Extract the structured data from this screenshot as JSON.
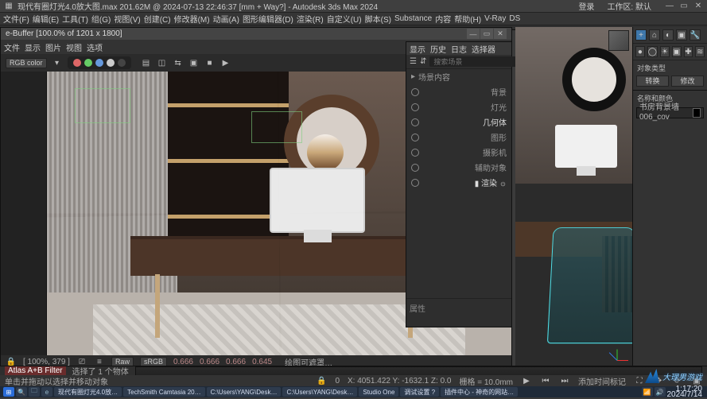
{
  "app": {
    "title": "现代有圈灯光4.0放大图.max  201.62M @ 2024-07-13 22:46:37  [mm + Way?]  - Autodesk 3ds Max 2024",
    "title_right_1": "登录",
    "title_right_2": "工作区: 默认"
  },
  "menubar": {
    "items": [
      "文件(F)",
      "编辑(E)",
      "工具(T)",
      "组(G)",
      "视图(V)",
      "创建(C)",
      "修改器(M)",
      "动画(A)",
      "图形编辑器(D)",
      "渲染(R)",
      "自定义(U)",
      "脚本(S)",
      "Substance",
      "内容",
      "帮助(H)",
      "V-Ray",
      "DS"
    ]
  },
  "frame_buffer": {
    "title": "e-Buffer  [100.0% of 1201 x 1800]",
    "win_btns": [
      "—",
      "▭",
      "✕"
    ],
    "topmenu": [
      "文件",
      "显示",
      "图片",
      "视图",
      "选项"
    ],
    "channel_label": "RGB color",
    "bottom_coord": "[ 100%, 379 ]",
    "bottom_mode_raw": "Raw",
    "bottom_mode_srgb": "sRGB",
    "bottom_vals": [
      "0.666",
      "0.666",
      "0.666",
      "0.645"
    ],
    "bottom_extra": "绘图可遮罩…"
  },
  "scene_panel": {
    "tabs": [
      "显示",
      "历史",
      "日志",
      "选择器"
    ],
    "search_placeholder": "搜索场景",
    "root": "场景内容",
    "items": [
      "背景",
      "灯光",
      "几何体",
      "图形",
      "摄影机",
      "辅助对象",
      "▮ 渲染 ☼"
    ],
    "footer_label": "属性"
  },
  "right_panel": {
    "icon_hints": [
      "plus",
      "brush",
      "hier",
      "util",
      "hammer",
      "play",
      "wrench"
    ],
    "section_type_title": "对象类型",
    "type_buttons": [
      "转换",
      "修改"
    ],
    "section_name_title": "名称和颜色",
    "name_value": "书房背景墙006_cov"
  },
  "timeline": {
    "frame_current": "0"
  },
  "selection_bar": {
    "hint1": "选择了 1 个物体",
    "hint2": "单击并拖动以选择并移动对象",
    "field_label": "Atlas A+B Filter"
  },
  "statusbar": {
    "left_frame": "0",
    "coords": "X: 4051.422  Y: -1632.1  Z: 0.0",
    "grid": "栅格 = 10.0mm",
    "extra": "添加时间标记"
  },
  "taskbar": {
    "items": [
      "现代有圈灯光4.0放…",
      "TechSmith Camtasia 20…",
      "C:\\Users\\YANG\\Desk…",
      "C:\\Users\\YANG\\Desk…",
      "Studio One",
      "调试设置 ?",
      "插件中心 - 神奇的网站…"
    ],
    "time": "1:17:20",
    "date": "2024/7/14"
  },
  "watermark": {
    "text": "大理男游戏"
  }
}
